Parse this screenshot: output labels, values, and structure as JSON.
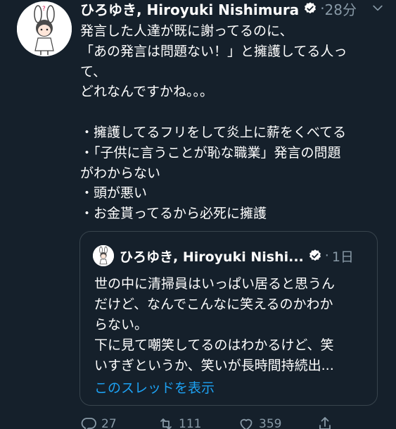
{
  "tweet": {
    "display_name": "ひろゆき, Hiroyuki Nishimura",
    "separator": "·",
    "time": "28分",
    "body_lines": [
      "発言した人達が既に謝ってるのに、",
      "「あの発言は問題ない！」と擁護してる人っ",
      "て、",
      "どれなんですかね。。。",
      "",
      "・擁護してるフリをして炎上に薪をくべてる",
      "・「子供に言うことが恥な職業」発言の問題",
      "がわからない",
      "・頭が悪い",
      "・お金貰ってるから必死に擁護"
    ]
  },
  "quoted": {
    "display_name": "ひろゆき, Hiroyuki Nishi...",
    "separator": "·",
    "time": "1日",
    "text_lines": [
      "世の中に清掃員はいっぱい居ると思うん",
      "だけど、なんでこんなに笑えるのかわか",
      "らない。",
      "下に見て嘲笑してるのはわかるけど、笑",
      "いすぎというか、笑いが長時間持続出..."
    ],
    "show_thread_label": "このスレッドを表示"
  },
  "actions": {
    "reply_count": "27",
    "retweet_count": "111",
    "like_count": "359",
    "share_label": ""
  },
  "colors": {
    "background": "#15202b",
    "text": "#ffffff",
    "secondary": "#8899a6",
    "link": "#1da1f2",
    "border": "#38444d"
  },
  "icons": {
    "verified": "verified-icon",
    "chevron": "chevron-down-icon",
    "reply": "reply-icon",
    "retweet": "retweet-icon",
    "like": "heart-icon",
    "share": "share-icon"
  }
}
